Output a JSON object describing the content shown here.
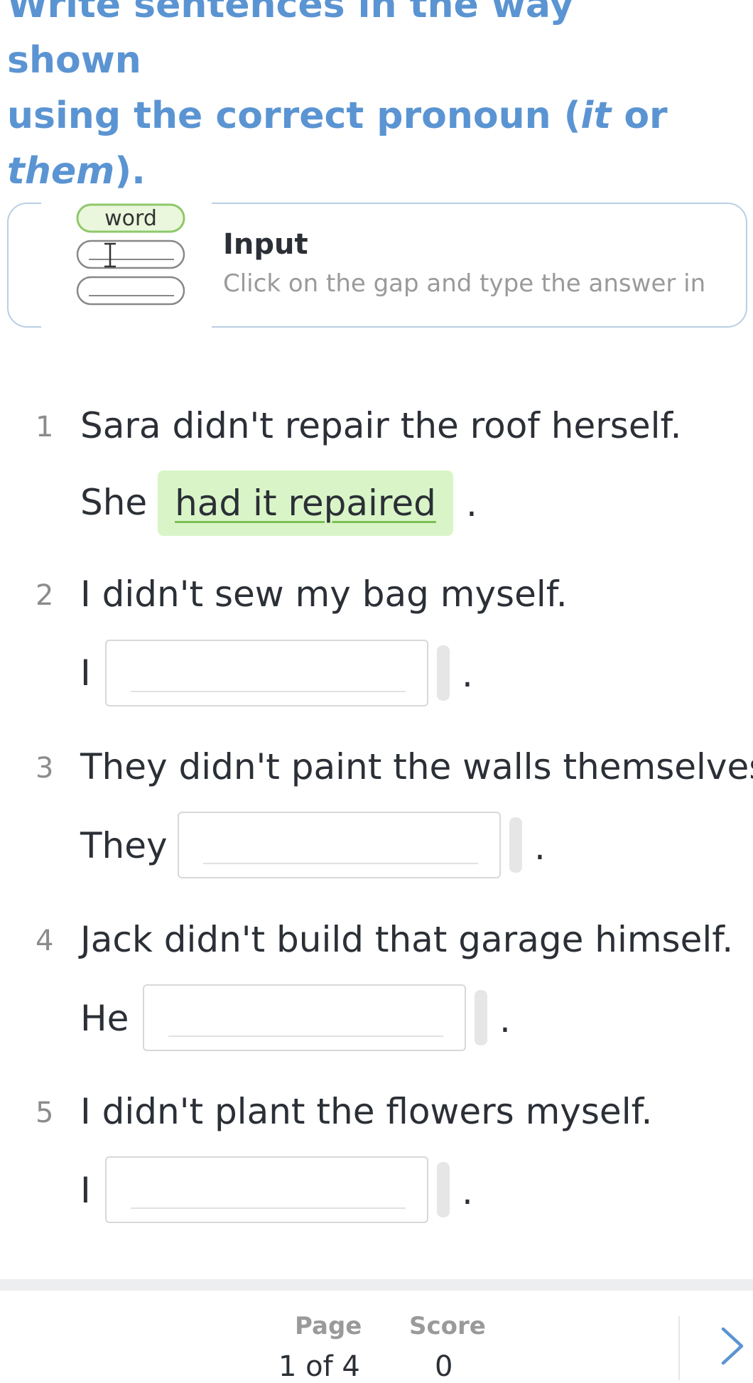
{
  "instruction": {
    "line1": "Write sentences in the way shown",
    "line2_prefix": "using the correct pronoun (",
    "line2_it": "it",
    "line2_or": " or",
    "line3_them": "them",
    "line3_suffix": ")."
  },
  "hint": {
    "illustration_word": "word",
    "title": "Input",
    "description": "Click on the gap and type the answer in"
  },
  "items": [
    {
      "number": "1",
      "sentence": "Sara didn't repair the roof herself.",
      "subject": "She",
      "answer": "had it repaired",
      "period": "."
    },
    {
      "number": "2",
      "sentence": "I didn't sew my bag myself.",
      "subject": "I",
      "answer": "",
      "period": "."
    },
    {
      "number": "3",
      "sentence": "They didn't paint the walls themselves.",
      "subject": "They",
      "answer": "",
      "period": "."
    },
    {
      "number": "4",
      "sentence": "Jack didn't build that garage himself.",
      "subject": "He",
      "answer": "",
      "period": "."
    },
    {
      "number": "5",
      "sentence": "I didn't plant the flowers myself.",
      "subject": "I",
      "answer": "",
      "period": "."
    }
  ],
  "footer": {
    "page_label": "Page",
    "page_value": "1 of 4",
    "score_label": "Score",
    "score_value": "0",
    "next_icon": "chevron-right-icon"
  },
  "colors": {
    "instruction": "#5b94d2",
    "filled_answer_bg": "#d9f5c7",
    "hint_border": "#b9cfe3"
  }
}
